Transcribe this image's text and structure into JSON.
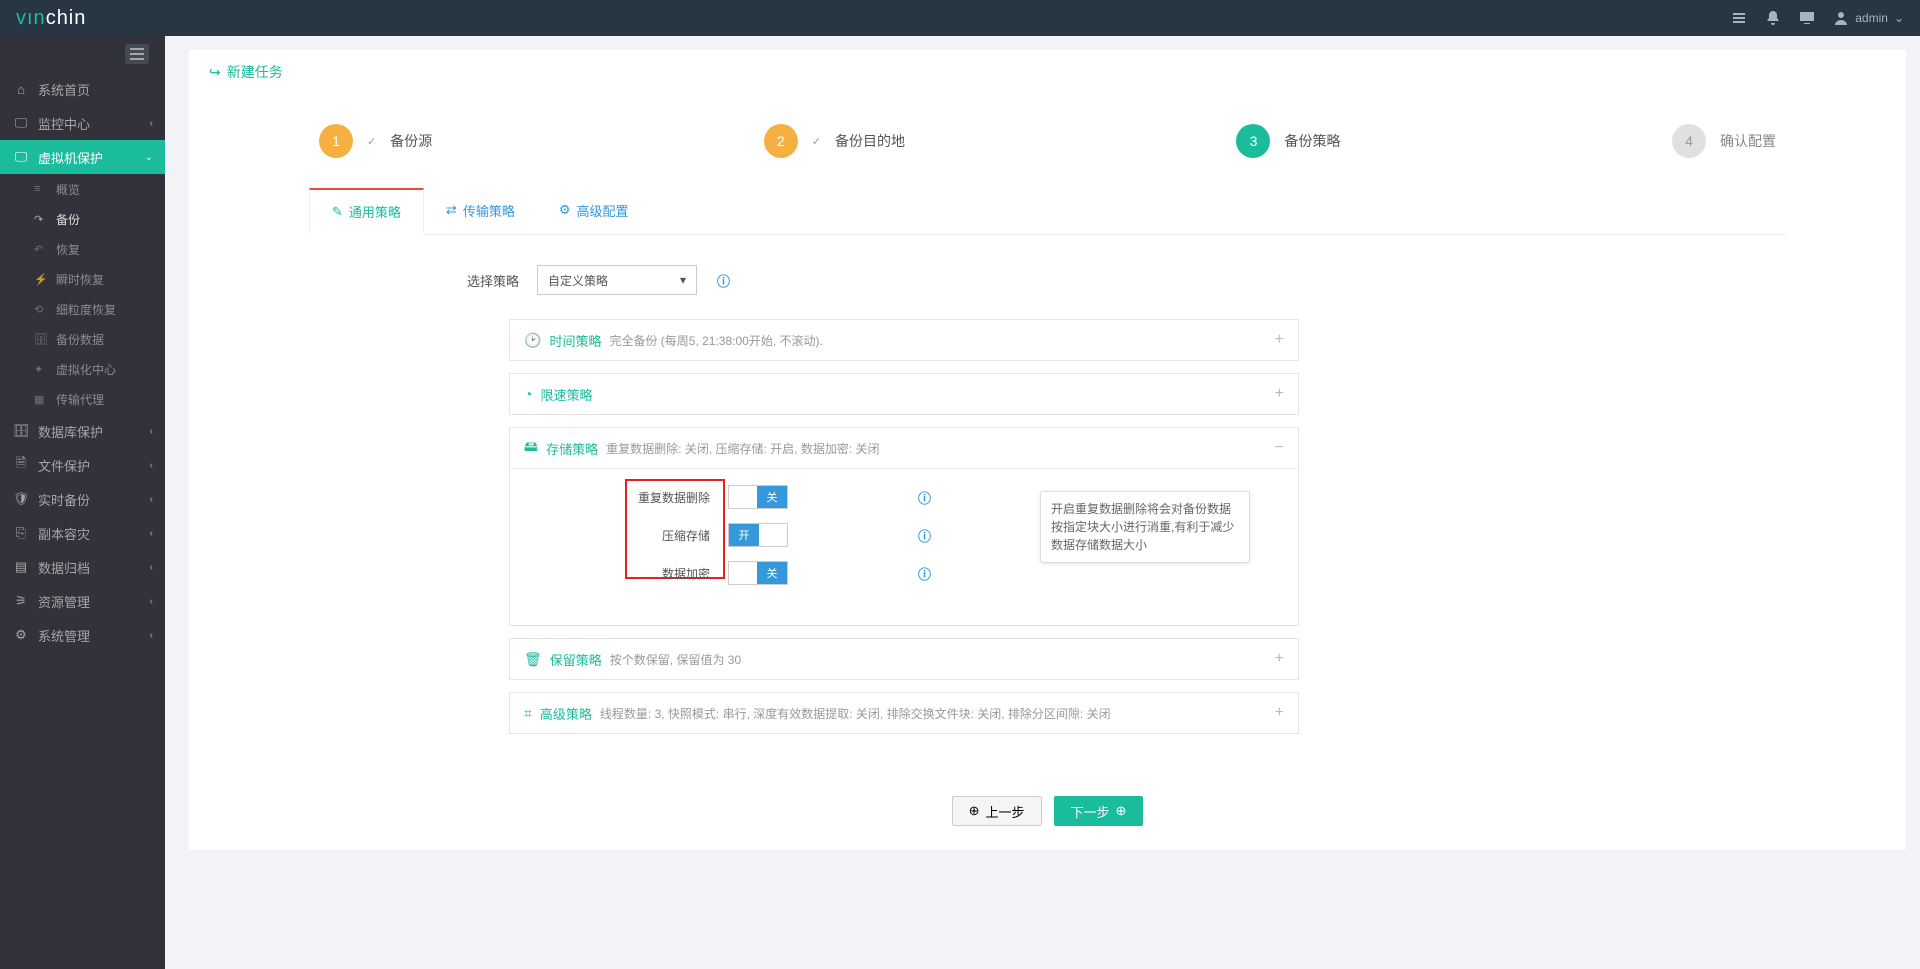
{
  "brand": {
    "part1": "vın",
    "part2": "chin"
  },
  "header": {
    "user": "admin"
  },
  "sidebar": {
    "items": [
      {
        "label": "系统首页",
        "icon": "⌂"
      },
      {
        "label": "监控中心",
        "icon": "🖵",
        "chev": true
      },
      {
        "label": "虚拟机保护",
        "icon": "🖵",
        "chev": true,
        "active": true
      },
      {
        "label": "数据库保护",
        "icon": "🗄",
        "chev": true
      },
      {
        "label": "文件保护",
        "icon": "🗎",
        "chev": true
      },
      {
        "label": "实时备份",
        "icon": "🛡",
        "chev": true
      },
      {
        "label": "副本容灾",
        "icon": "⎘",
        "chev": true
      },
      {
        "label": "数据归档",
        "icon": "▤",
        "chev": true
      },
      {
        "label": "资源管理",
        "icon": "⚞",
        "chev": true
      },
      {
        "label": "系统管理",
        "icon": "⚙",
        "chev": true
      }
    ],
    "sub": [
      {
        "label": "概览",
        "icon": "≡"
      },
      {
        "label": "备份",
        "icon": "↷",
        "active": true
      },
      {
        "label": "恢复",
        "icon": "↶"
      },
      {
        "label": "瞬时恢复",
        "icon": "⚡"
      },
      {
        "label": "细粒度恢复",
        "icon": "⟲"
      },
      {
        "label": "备份数据",
        "icon": "🗄"
      },
      {
        "label": "虚拟化中心",
        "icon": "✦"
      },
      {
        "label": "传输代理",
        "icon": "▦"
      }
    ]
  },
  "page": {
    "title": "新建任务"
  },
  "steps": [
    {
      "num": "1",
      "label": "备份源",
      "state": "done",
      "check": true
    },
    {
      "num": "2",
      "label": "备份目的地",
      "state": "done",
      "check": true
    },
    {
      "num": "3",
      "label": "备份策略",
      "state": "current"
    },
    {
      "num": "4",
      "label": "确认配置",
      "state": "todo"
    }
  ],
  "tabs": [
    {
      "label": "通用策略",
      "icon": "✎",
      "active": true
    },
    {
      "label": "传输策略",
      "icon": "⇄"
    },
    {
      "label": "高级配置",
      "icon": "⚙"
    }
  ],
  "form": {
    "select_label": "选择策略",
    "select_value": "自定义策略"
  },
  "accordions": {
    "time": {
      "title": "时间策略",
      "desc": "完全备份 (每周5, 21:38:00开始, 不滚动)."
    },
    "speed": {
      "title": "限速策略",
      "desc": ""
    },
    "storage": {
      "title": "存储策略",
      "desc": "重复数据删除: 关闭, 压缩存储: 开启, 数据加密: 关闭"
    },
    "retain": {
      "title": "保留策略",
      "desc": "按个数保留, 保留值为 30"
    },
    "adv": {
      "title": "高级策略",
      "desc": "线程数量: 3, 快照模式: 串行, 深度有效数据提取: 关闭, 排除交换文件块: 关闭, 排除分区间隙: 关闭"
    }
  },
  "storage_opts": {
    "dedup": {
      "label": "重复数据删除",
      "state": "off",
      "text": "关"
    },
    "compress": {
      "label": "压缩存储",
      "state": "on",
      "text": "开"
    },
    "encrypt": {
      "label": "数据加密",
      "state": "off",
      "text": "关"
    }
  },
  "tooltip": "开启重复数据删除将会对备份数据按指定块大小进行消重,有利于减少数据存储数据大小",
  "buttons": {
    "prev": "上一步",
    "next": "下一步"
  }
}
